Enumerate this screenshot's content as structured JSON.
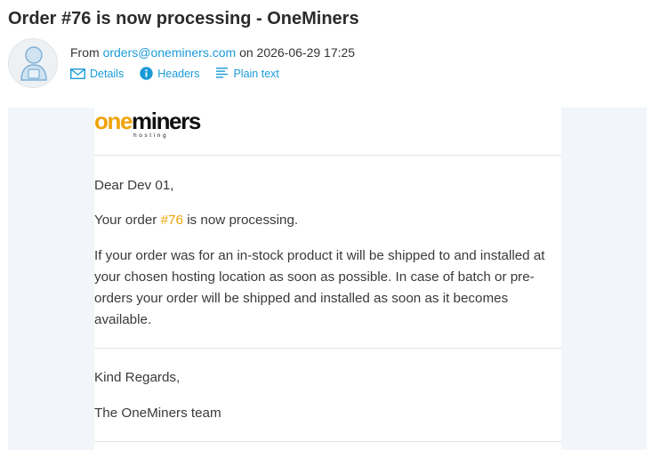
{
  "email": {
    "subject": "Order #76 is now processing - OneMiners",
    "from_prefix": "From",
    "from_address": "orders@oneminers.com",
    "date_prefix": "on",
    "date": "2026-06-29 17:25"
  },
  "actions": {
    "details": "Details",
    "headers": "Headers",
    "plain_text": "Plain text"
  },
  "logo": {
    "part1": "one",
    "part2": "miners",
    "sub": "hosting"
  },
  "body": {
    "greeting": "Dear Dev 01,",
    "order_prefix": "Your order",
    "order_number": "#76",
    "order_suffix": "is now processing.",
    "paragraph": "If your order was for an in-stock product it will be shipped to and installed at your chosen hosting location as soon as possible. In case of batch or pre-orders your order will be shipped and installed as soon as it becomes available.",
    "regards": "Kind Regards,",
    "signature": "The OneMiners team"
  },
  "colors": {
    "link": "#1a9bd7",
    "accent": "#f0a30a",
    "mail_background": "#f2f5f9"
  }
}
